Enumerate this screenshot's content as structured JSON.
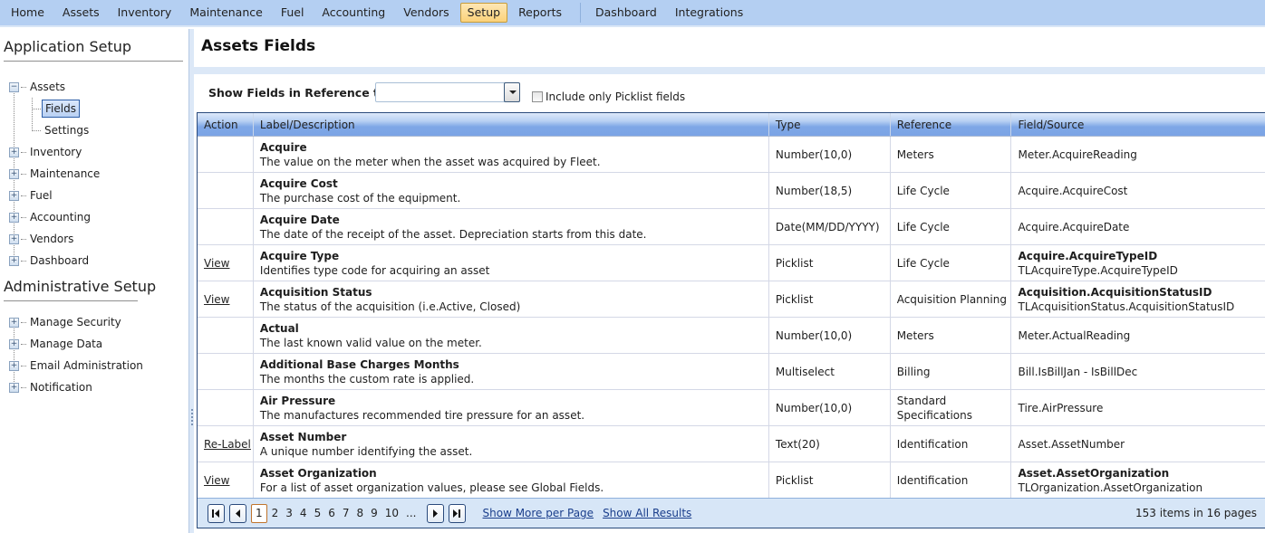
{
  "topnav": {
    "items": [
      {
        "label": "Home",
        "active": false
      },
      {
        "label": "Assets",
        "active": false
      },
      {
        "label": "Inventory",
        "active": false
      },
      {
        "label": "Maintenance",
        "active": false
      },
      {
        "label": "Fuel",
        "active": false
      },
      {
        "label": "Accounting",
        "active": false
      },
      {
        "label": "Vendors",
        "active": false
      },
      {
        "label": "Setup",
        "active": true
      },
      {
        "label": "Reports",
        "active": false
      }
    ],
    "secondary": [
      {
        "label": "Dashboard"
      },
      {
        "label": "Integrations"
      }
    ]
  },
  "sidebar": {
    "app_title": "Application Setup",
    "app_items": [
      {
        "label": "Assets",
        "expanded": true,
        "children": [
          {
            "label": "Fields",
            "selected": true
          },
          {
            "label": "Settings",
            "selected": false
          }
        ]
      },
      {
        "label": "Inventory",
        "expanded": false
      },
      {
        "label": "Maintenance",
        "expanded": false
      },
      {
        "label": "Fuel",
        "expanded": false
      },
      {
        "label": "Accounting",
        "expanded": false
      },
      {
        "label": "Vendors",
        "expanded": false
      },
      {
        "label": "Dashboard",
        "expanded": false
      }
    ],
    "admin_title": "Administrative Setup",
    "admin_items": [
      {
        "label": "Manage Security"
      },
      {
        "label": "Manage Data"
      },
      {
        "label": "Email Administration"
      },
      {
        "label": "Notification"
      }
    ]
  },
  "main": {
    "title": "Assets Fields",
    "filter": {
      "label": "Show Fields in Reference to:",
      "value": "",
      "checkbox_label": "Include only Picklist fields",
      "checkbox_checked": false
    },
    "columns": [
      "Action",
      "Label/Description",
      "Type",
      "Reference",
      "Field/Source"
    ],
    "rows": [
      {
        "action": "",
        "label": "Acquire",
        "description": "The value on the meter when the asset was acquired by Fleet.",
        "type": "Number(10,0)",
        "reference": "Meters",
        "source_bold": "",
        "source": "Meter.AcquireReading"
      },
      {
        "action": "",
        "label": "Acquire Cost",
        "description": "The purchase cost of the equipment.",
        "type": "Number(18,5)",
        "reference": "Life Cycle",
        "source_bold": "",
        "source": "Acquire.AcquireCost"
      },
      {
        "action": "",
        "label": "Acquire Date",
        "description": "The date of the receipt of the asset. Depreciation starts from this date.",
        "type": "Date(MM/DD/YYYY)",
        "reference": "Life Cycle",
        "source_bold": "",
        "source": "Acquire.AcquireDate"
      },
      {
        "action": "View",
        "label": "Acquire Type",
        "description": "Identifies type code for acquiring an asset",
        "type": "Picklist",
        "reference": "Life Cycle",
        "source_bold": "Acquire.AcquireTypeID",
        "source": "TLAcquireType.AcquireTypeID"
      },
      {
        "action": "View",
        "label": "Acquisition Status",
        "description": "The status of the acquisition (i.e.Active, Closed)",
        "type": "Picklist",
        "reference": "Acquisition Planning",
        "source_bold": "Acquisition.AcquisitionStatusID",
        "source": "TLAcquisitionStatus.AcquisitionStatusID"
      },
      {
        "action": "",
        "label": "Actual",
        "description": "The last known valid value on the meter.",
        "type": "Number(10,0)",
        "reference": "Meters",
        "source_bold": "",
        "source": "Meter.ActualReading"
      },
      {
        "action": "",
        "label": "Additional Base Charges Months",
        "description": "The months the custom rate is applied.",
        "type": "Multiselect",
        "reference": "Billing",
        "source_bold": "",
        "source": "Bill.IsBillJan - IsBillDec"
      },
      {
        "action": "",
        "label": "Air Pressure",
        "description": "The manufactures recommended tire pressure for an asset.",
        "type": "Number(10,0)",
        "reference": "Standard Specifications",
        "source_bold": "",
        "source": "Tire.AirPressure"
      },
      {
        "action": "Re-Label",
        "label": "Asset Number",
        "description": "A unique number identifying the asset.",
        "type": "Text(20)",
        "reference": "Identification",
        "source_bold": "",
        "source": "Asset.AssetNumber"
      },
      {
        "action": "View",
        "label": "Asset Organization",
        "description": "For a list of asset organization values, please see Global Fields.",
        "type": "Picklist",
        "reference": "Identification",
        "source_bold": "Asset.AssetOrganization",
        "source": "TLOrganization.AssetOrganization"
      }
    ],
    "pager": {
      "pages": [
        "1",
        "2",
        "3",
        "4",
        "5",
        "6",
        "7",
        "8",
        "9",
        "10",
        "..."
      ],
      "current_page": "1",
      "show_more": "Show More per Page",
      "show_all": "Show All Results",
      "summary": "153 items in 16 pages"
    }
  }
}
